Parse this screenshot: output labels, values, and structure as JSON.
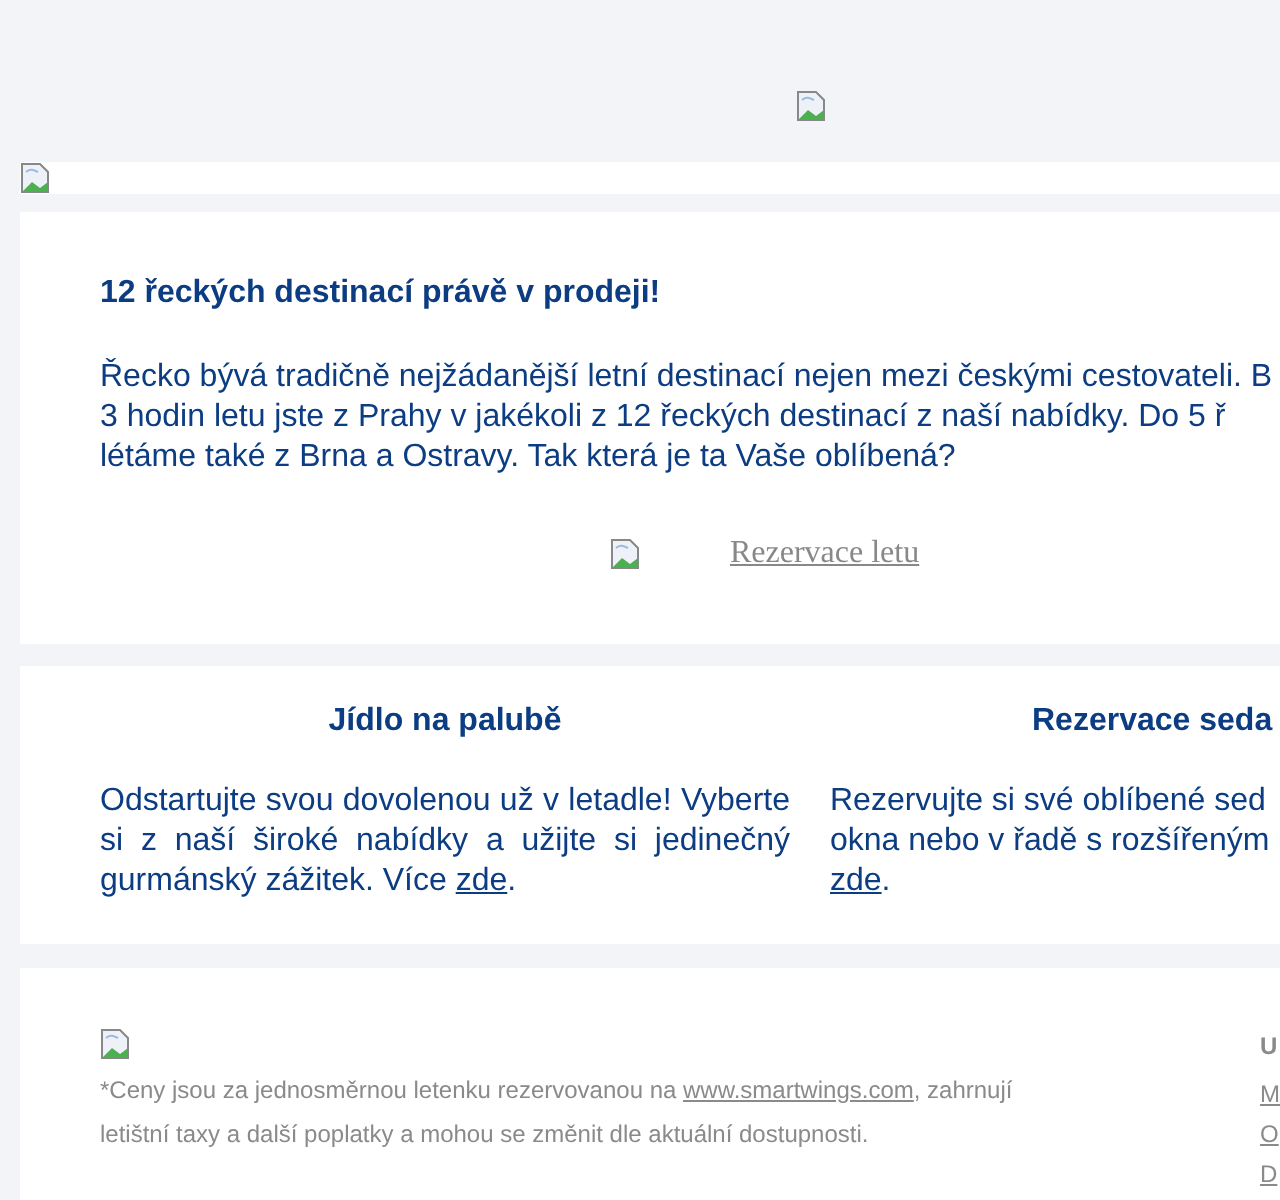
{
  "promo": {
    "title": "12 řeckých destinací právě v prodeji!",
    "lines": [
      "Řecko bývá tradičně nejžádanější letní destinací nejen mezi českými cestovateli. B",
      "3 hodin letu jste z Prahy v jakékoli z 12 řeckých destinací z naší nabídky. Do 5 ř",
      "létáme také z Brna a Ostravy. Tak která je ta Vaše oblíbená?"
    ],
    "button": {
      "label": "Rezervace letu"
    }
  },
  "features": [
    {
      "title": "Jídlo na palubě",
      "lines": [
        "Odstartujte svou dovolenou už v letadle! Vyberte",
        "si z naší široké nabídky a užijte si jedinečný"
      ],
      "last_text": "gurmánský zážitek. Více ",
      "link": "zde",
      "after": "."
    },
    {
      "title": "Rezervace seda",
      "lines": [
        "Rezervujte si své oblíbené sed",
        "okna nebo v řadě s rozšířeným"
      ],
      "link": "zde",
      "after": "."
    }
  ],
  "footer": {
    "disclaimer_before": "*Ceny jsou za jednosměrnou letenku rezervovanou na ",
    "disclaimer_link": "www.smartwings.com",
    "disclaimer_after": ", zahrnují letištní taxy a další poplatky a mohou se změnit dle aktuální dostupnosti.",
    "side_heading": "U",
    "side_links": [
      "M",
      "O",
      "D"
    ]
  }
}
